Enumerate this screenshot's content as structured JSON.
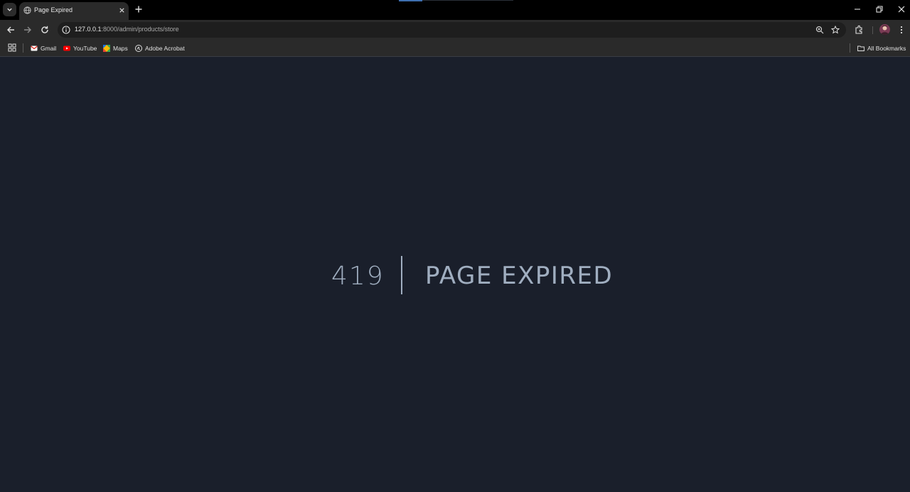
{
  "browser": {
    "tab": {
      "title": "Page Expired"
    },
    "address_bar": {
      "host": "127.0.0.1",
      "path": ":8000/admin/products/store"
    },
    "bookmarks": [
      {
        "label": "Gmail",
        "icon": "gmail-icon"
      },
      {
        "label": "YouTube",
        "icon": "youtube-icon"
      },
      {
        "label": "Maps",
        "icon": "maps-icon"
      },
      {
        "label": "Adobe Acrobat",
        "icon": "acrobat-icon"
      }
    ],
    "all_bookmarks_label": "All Bookmarks"
  },
  "page": {
    "code": "419",
    "message": "PAGE EXPIRED"
  },
  "colors": {
    "page_background": "#1a1f2b",
    "error_text": "#a0aec0",
    "browser_chrome": "#2a2a2a"
  }
}
